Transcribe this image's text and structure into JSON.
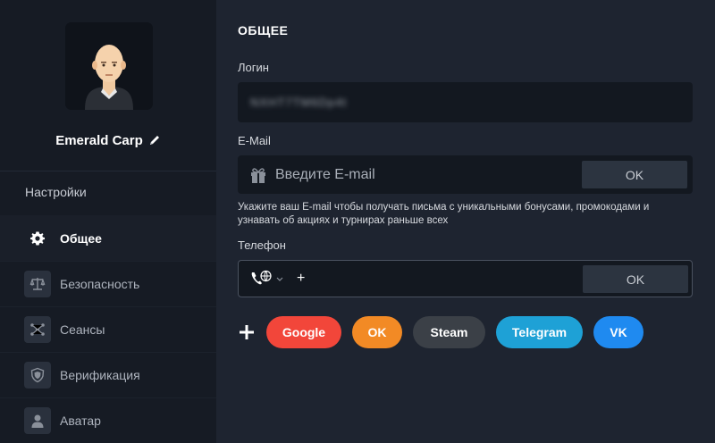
{
  "sidebar": {
    "username": "Emerald Carp",
    "settings_label": "Настройки",
    "items": [
      {
        "label": "Общее",
        "icon": "gear-icon",
        "active": true
      },
      {
        "label": "Безопасность",
        "icon": "scales-icon",
        "active": false
      },
      {
        "label": "Сеансы",
        "icon": "network-icon",
        "active": false
      },
      {
        "label": "Верификация",
        "icon": "shield-icon",
        "active": false
      },
      {
        "label": "Аватар",
        "icon": "user-icon",
        "active": false
      }
    ]
  },
  "main": {
    "title": "ОБЩЕЕ",
    "login_label": "Логин",
    "login_value": "NXHT7TM6Dp4t",
    "email_label": "E-Mail",
    "email_placeholder": "Введите E-mail",
    "email_ok": "OK",
    "email_hint": "Укажите ваш E-mail чтобы получать письма с уникальными бонусами, промокодами и узнавать об акциях и турнирах раньше всех",
    "phone_label": "Телефон",
    "phone_value": "+",
    "phone_ok": "OK"
  },
  "socials": {
    "google": "Google",
    "ok": "OK",
    "steam": "Steam",
    "telegram": "Telegram",
    "vk": "VK"
  },
  "colors": {
    "google": "#f2463a",
    "ok": "#f28a25",
    "steam": "#3b4047",
    "telegram": "#1ea1d6",
    "vk": "#1f8af0"
  }
}
